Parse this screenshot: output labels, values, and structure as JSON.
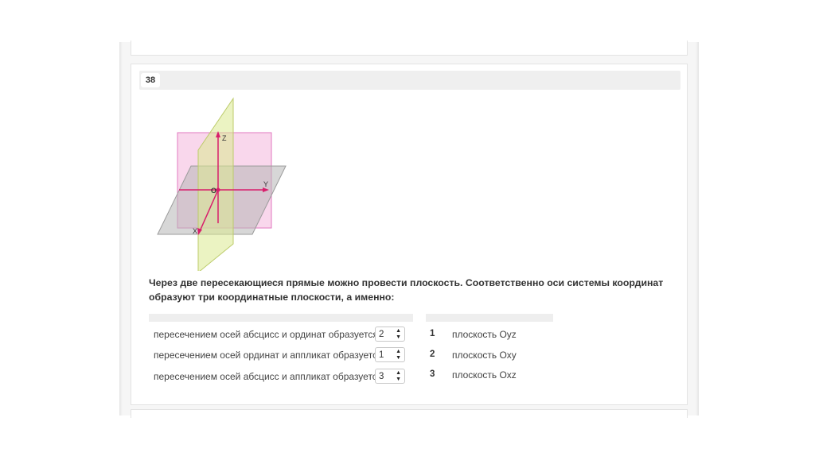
{
  "question": {
    "number": "38",
    "text": "Через две пересекающиеся прямые можно провести плоскость. Соответственно оси системы координат образуют три координатные плоскости, а именно:"
  },
  "figure": {
    "axis_z": "Z",
    "axis_y": "Y",
    "axis_x": "X",
    "origin": "O",
    "colors": {
      "axes": "#e0206e",
      "plane_xy": "#a8a8a8",
      "plane_yz": "#f2a6d2",
      "plane_xz": "#d9e88a"
    }
  },
  "rows": [
    {
      "text": "пересечением осей абсцисс и ординат образуется",
      "selected": "2"
    },
    {
      "text": "пересечением осей ординат и аппликат образуется",
      "selected": "1"
    },
    {
      "text": "пересечением осей абсцисс и аппликат образуется",
      "selected": "3"
    }
  ],
  "answers": [
    {
      "num": "1",
      "text": "плоскость Oyz"
    },
    {
      "num": "2",
      "text": "плоскость Oxy"
    },
    {
      "num": "3",
      "text": "плоскость Oxz"
    }
  ]
}
